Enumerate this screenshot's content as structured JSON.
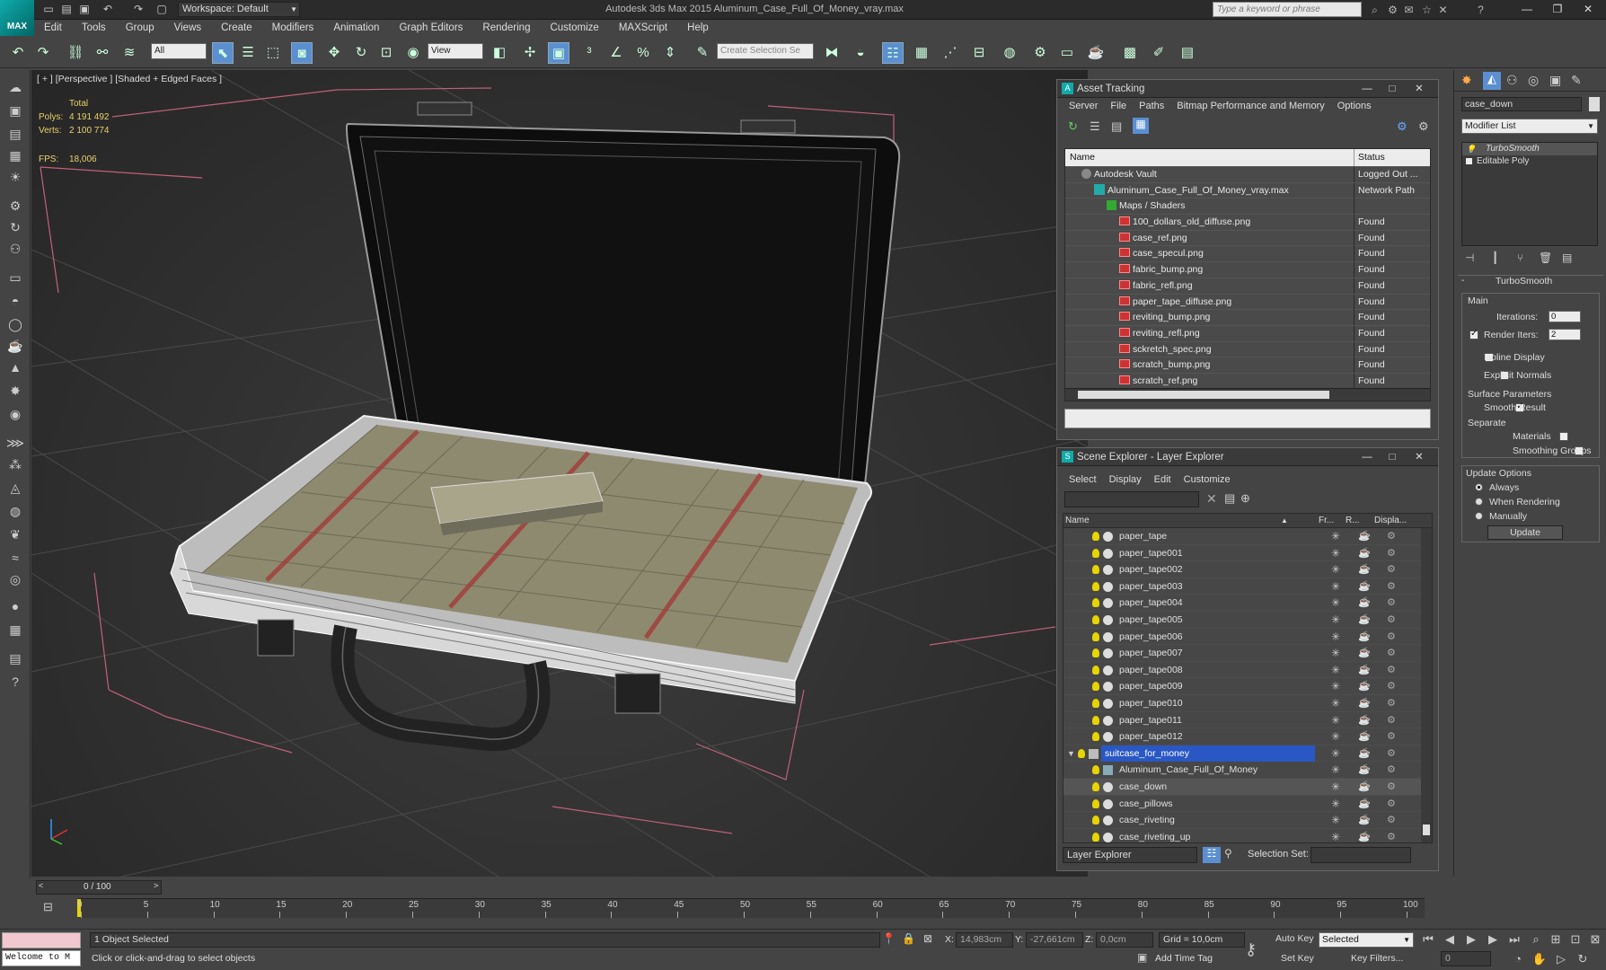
{
  "titlebar": {
    "app_logo": "MAX",
    "workspace": "Workspace: Default",
    "title": "Autodesk 3ds Max 2015    Aluminum_Case_Full_Of_Money_vray.max",
    "search_placeholder": "Type a keyword or phrase"
  },
  "menu": [
    "Edit",
    "Tools",
    "Group",
    "Views",
    "Create",
    "Modifiers",
    "Animation",
    "Graph Editors",
    "Rendering",
    "Customize",
    "MAXScript",
    "Help"
  ],
  "toolbar": {
    "selection_filter": "All",
    "reference_coord": "View",
    "named_selection_placeholder": "Create Selection Se"
  },
  "viewport": {
    "label": "[ + ] [Perspective ] [Shaded + Edged Faces ]",
    "stats_header": "Total",
    "polys_label": "Polys:",
    "polys_value": "4 191 492",
    "verts_label": "Verts:",
    "verts_value": "2 100 774",
    "fps_label": "FPS:",
    "fps_value": "18,006"
  },
  "asset_tracking": {
    "title": "Asset Tracking",
    "menu": [
      "Server",
      "File",
      "Paths",
      "Bitmap Performance and Memory",
      "Options"
    ],
    "columns": [
      "Name",
      "Status"
    ],
    "rows": [
      {
        "name": "Autodesk Vault",
        "status": "Logged Out ...",
        "indent": 1,
        "icon": "vault"
      },
      {
        "name": "Aluminum_Case_Full_Of_Money_vray.max",
        "status": "Network Path",
        "indent": 2,
        "icon": "max"
      },
      {
        "name": "Maps / Shaders",
        "status": "",
        "indent": 3,
        "icon": "maps"
      },
      {
        "name": "100_dollars_old_diffuse.png",
        "status": "Found",
        "indent": 4,
        "icon": "png"
      },
      {
        "name": "case_ref.png",
        "status": "Found",
        "indent": 4,
        "icon": "png"
      },
      {
        "name": "case_specul.png",
        "status": "Found",
        "indent": 4,
        "icon": "png"
      },
      {
        "name": "fabric_bump.png",
        "status": "Found",
        "indent": 4,
        "icon": "png"
      },
      {
        "name": "fabric_refl.png",
        "status": "Found",
        "indent": 4,
        "icon": "png"
      },
      {
        "name": "paper_tape_diffuse.png",
        "status": "Found",
        "indent": 4,
        "icon": "png"
      },
      {
        "name": "reviting_bump.png",
        "status": "Found",
        "indent": 4,
        "icon": "png"
      },
      {
        "name": "reviting_refl.png",
        "status": "Found",
        "indent": 4,
        "icon": "png"
      },
      {
        "name": "sckretch_spec.png",
        "status": "Found",
        "indent": 4,
        "icon": "png"
      },
      {
        "name": "scratch_bump.png",
        "status": "Found",
        "indent": 4,
        "icon": "png"
      },
      {
        "name": "scratch_ref.png",
        "status": "Found",
        "indent": 4,
        "icon": "png"
      }
    ]
  },
  "scene_explorer": {
    "title": "Scene Explorer - Layer Explorer",
    "menu": [
      "Select",
      "Display",
      "Edit",
      "Customize"
    ],
    "columns": [
      "Name",
      "Fr...",
      "R...",
      "Displa..."
    ],
    "rows": [
      {
        "name": "paper_tape",
        "indent": 2
      },
      {
        "name": "paper_tape001",
        "indent": 2
      },
      {
        "name": "paper_tape002",
        "indent": 2
      },
      {
        "name": "paper_tape003",
        "indent": 2
      },
      {
        "name": "paper_tape004",
        "indent": 2
      },
      {
        "name": "paper_tape005",
        "indent": 2
      },
      {
        "name": "paper_tape006",
        "indent": 2
      },
      {
        "name": "paper_tape007",
        "indent": 2
      },
      {
        "name": "paper_tape008",
        "indent": 2
      },
      {
        "name": "paper_tape009",
        "indent": 2
      },
      {
        "name": "paper_tape010",
        "indent": 2
      },
      {
        "name": "paper_tape011",
        "indent": 2
      },
      {
        "name": "paper_tape012",
        "indent": 2
      },
      {
        "name": "suitcase_for_money",
        "indent": 1,
        "selected": true,
        "layer": true
      },
      {
        "name": "Aluminum_Case_Full_Of_Money",
        "indent": 2,
        "group": true
      },
      {
        "name": "case_down",
        "indent": 2,
        "highlight": true
      },
      {
        "name": "case_pillows",
        "indent": 2
      },
      {
        "name": "case_riveting",
        "indent": 2
      },
      {
        "name": "case_riveting_up",
        "indent": 2
      }
    ],
    "footer_mode": "Layer Explorer",
    "selection_set_label": "Selection Set:"
  },
  "command_panel": {
    "object_name": "case_down",
    "modifier_list": "Modifier List",
    "stack": [
      "TurboSmooth",
      "Editable Poly"
    ],
    "rollout_title": "TurboSmooth",
    "main_label": "Main",
    "iterations_label": "Iterations:",
    "iterations_value": "0",
    "render_iters_label": "Render Iters:",
    "render_iters_value": "2",
    "isoline_label": "Isoline Display",
    "explicit_normals_label": "Explicit Normals",
    "surface_params_label": "Surface Parameters",
    "smooth_result_label": "Smooth Result",
    "separate_label": "Separate",
    "materials_label": "Materials",
    "smoothing_groups_label": "Smoothing Groups",
    "update_options_label": "Update Options",
    "always_label": "Always",
    "when_rendering_label": "When Rendering",
    "manually_label": "Manually",
    "update_button": "Update"
  },
  "timeline": {
    "frame_counter": "0 / 100",
    "ticks": [
      "0",
      "5",
      "10",
      "15",
      "20",
      "25",
      "30",
      "35",
      "40",
      "45",
      "50",
      "55",
      "60",
      "65",
      "70",
      "75",
      "80",
      "85",
      "90",
      "95",
      "100"
    ]
  },
  "status": {
    "maxscript_listener": "Welcome to M",
    "selected_count": "1 Object Selected",
    "prompt": "Click or click-and-drag to select objects",
    "x_label": "X:",
    "x_value": "14,983cm",
    "y_label": "Y:",
    "y_value": "-27,661cm",
    "z_label": "Z:",
    "z_value": "0,0cm",
    "grid": "Grid = 10,0cm",
    "add_time_tag": "Add Time Tag",
    "auto_key": "Auto Key",
    "set_key": "Set Key",
    "key_mode": "Selected",
    "key_filters": "Key Filters...",
    "current_frame": "0"
  }
}
